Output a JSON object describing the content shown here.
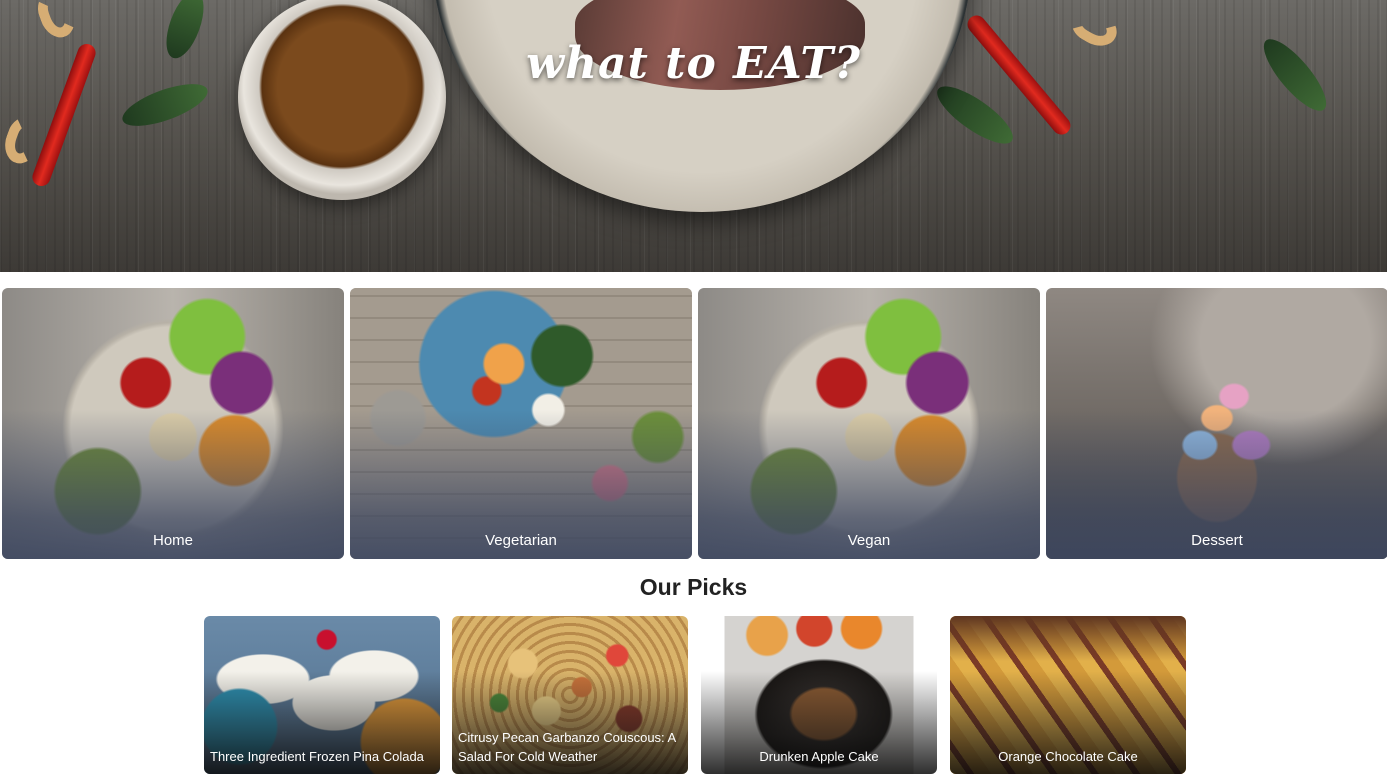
{
  "hero": {
    "title": "what to EAT?"
  },
  "categories": [
    {
      "label": "Home"
    },
    {
      "label": "Vegetarian"
    },
    {
      "label": "Vegan"
    },
    {
      "label": "Dessert"
    }
  ],
  "picks": {
    "title": "Our Picks",
    "items": [
      {
        "label": "Three Ingredient Frozen Pina Colada"
      },
      {
        "label": "Citrusy Pecan Garbanzo Couscous: A Salad For Cold Weather"
      },
      {
        "label": "Drunken Apple Cake"
      },
      {
        "label": "Orange Chocolate Cake"
      }
    ]
  }
}
